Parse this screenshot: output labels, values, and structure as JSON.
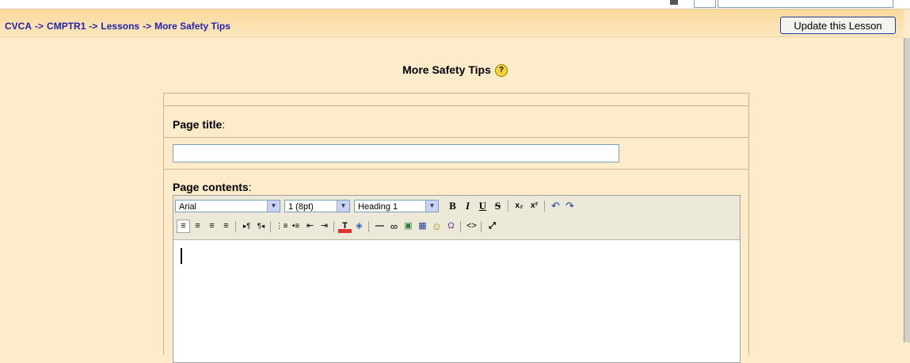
{
  "breadcrumb": {
    "items": [
      "CVCA",
      "CMPTR1",
      "Lessons",
      "More Safety Tips"
    ],
    "separator": "->"
  },
  "header": {
    "update_button": "Update this Lesson"
  },
  "page": {
    "title": "More Safety Tips",
    "help_glyph": "?"
  },
  "form": {
    "page_title_label": "Page title",
    "page_title_value": "",
    "page_contents_label": "Page contents",
    "label_colon": ":"
  },
  "editor": {
    "font_family": "Arial",
    "font_size": "1 (8pt)",
    "format": "Heading 1",
    "buttons_row1": {
      "bold": "B",
      "italic": "I",
      "underline": "U",
      "strike": "S",
      "subscript": "x₂",
      "superscript": "x²",
      "undo": "↶",
      "redo": "↷"
    },
    "buttons_row2": {
      "align_left": "≡",
      "align_center": "≡",
      "align_right": "≡",
      "justify": "≡",
      "ltr": "▸¶",
      "rtl": "¶◂",
      "ordered_list": "⋮≡",
      "unordered_list": "•≡",
      "outdent": "⇤",
      "indent": "⇥",
      "text_color": "T",
      "bg_color": "◈",
      "horizontal_rule": "—",
      "link": "∞",
      "image": "▣",
      "table": "▦",
      "smiley": "☺",
      "special_char": "Ω",
      "html_source": "<>",
      "fullscreen": "⤢"
    }
  },
  "colors": {
    "background": "#fdebc9",
    "navbar": "#fbd99b",
    "breadcrumb_link": "#2222aa",
    "border": "#c8b48c"
  }
}
